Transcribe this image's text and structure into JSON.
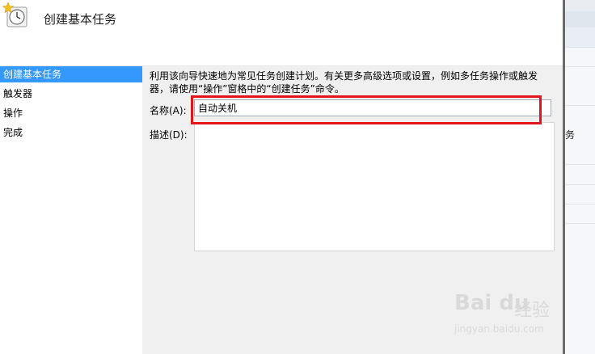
{
  "header": {
    "title": "创建基本任务",
    "icon": "task-scheduler-clock-icon"
  },
  "steps": [
    {
      "label": "创建基本任务",
      "active": true
    },
    {
      "label": "触发器",
      "active": false
    },
    {
      "label": "操作",
      "active": false
    },
    {
      "label": "完成",
      "active": false
    }
  ],
  "content": {
    "description": "利用该向导快速地为常见任务创建计划。有关更多高级选项或设置，例如多任务操作或触发器，请使用“操作”窗格中的“创建任务”命令。",
    "name_label": "名称(A):",
    "name_value": "自动关机",
    "desc_label": "描述(D):",
    "desc_value": ""
  },
  "background_window": {
    "partial_text": "务"
  },
  "watermark": {
    "logo": "Bai du",
    "text": "经验",
    "url": "jingyan.baidu.com"
  },
  "colors": {
    "selected_step": "#3399ff",
    "content_bg": "#f0f0f0",
    "highlight": "#e3141b"
  }
}
